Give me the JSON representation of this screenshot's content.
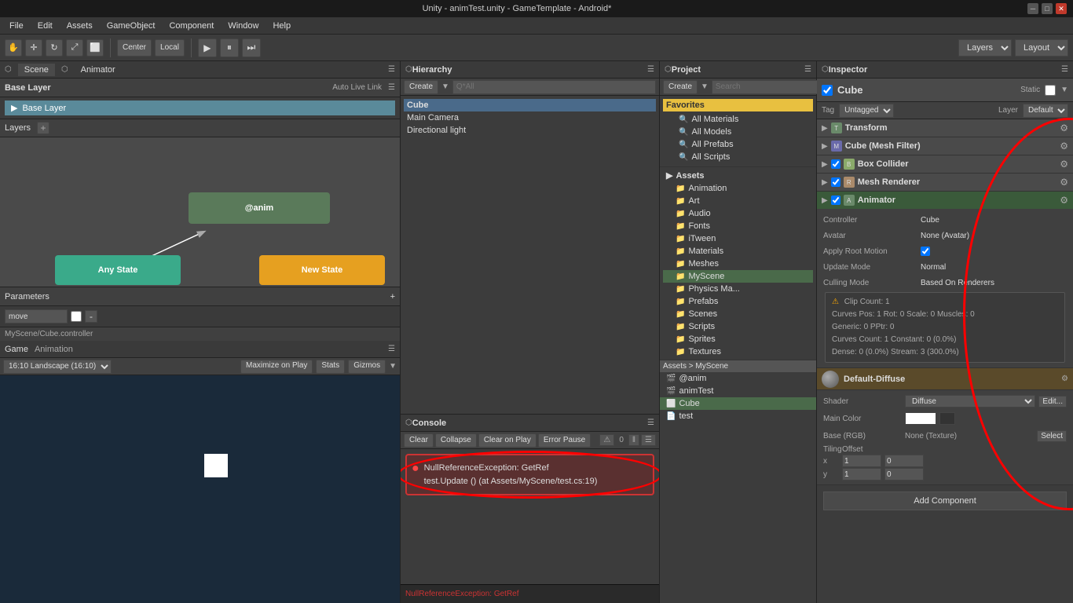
{
  "window": {
    "title": "Unity - animTest.unity - GameTemplate - Android*",
    "controls": [
      "minimize",
      "maximize",
      "close"
    ]
  },
  "menu": {
    "items": [
      "File",
      "Edit",
      "Assets",
      "GameObject",
      "Component",
      "Window",
      "Help"
    ]
  },
  "toolbar": {
    "tools": [
      "hand",
      "move",
      "rotate",
      "scale",
      "rect"
    ],
    "center_label": "Center",
    "local_label": "Local",
    "layers_label": "Layers",
    "layout_label": "Layout"
  },
  "scene_tab": "Scene",
  "animator_tab": "Animator",
  "animator": {
    "base_layer_label": "Base Layer",
    "auto_live_link": "Auto Live Link",
    "layers_label": "Layers",
    "add_layer_btn": "+",
    "params_label": "Parameters",
    "add_param_btn": "+",
    "param_name": "move",
    "footer_path": "MyScene/Cube.controller",
    "states": {
      "anim": "@anim",
      "any_state": "Any State",
      "new_state": "New State"
    }
  },
  "hierarchy": {
    "title": "Hierarchy",
    "create_btn": "Create",
    "search_placeholder": "Q*All",
    "items": [
      "Cube",
      "Main Camera",
      "Directional light"
    ]
  },
  "project": {
    "title": "Project",
    "create_btn": "Create",
    "search_placeholder": "Search",
    "favorites": {
      "label": "Favorites",
      "items": [
        "All Materials",
        "All Models",
        "All Prefabs",
        "All Scripts"
      ]
    },
    "assets": {
      "label": "Assets",
      "breadcrumb": "Assets > MyScene",
      "folders": [
        "Animation",
        "Art",
        "Audio",
        "Fonts",
        "iTween",
        "Materials",
        "Meshes",
        "MyScene",
        "Physics Ma...",
        "Prefabs",
        "Scenes",
        "Scripts",
        "Sprites",
        "Textures"
      ],
      "myscene_items": [
        "@anim",
        "animTest",
        "Cube",
        "test"
      ]
    }
  },
  "inspector": {
    "title": "Inspector",
    "object_name": "Cube",
    "static_label": "Static",
    "tag": "Untagged",
    "layer": "Default",
    "components": {
      "transform": "Transform",
      "mesh_filter": "Cube (Mesh Filter)",
      "box_collider": "Box Collider",
      "mesh_renderer": "Mesh Renderer",
      "animator": "Animator"
    },
    "animator_props": {
      "controller_label": "Controller",
      "controller_value": "Cube",
      "avatar_label": "Avatar",
      "avatar_value": "None (Avatar)",
      "apply_root_label": "Apply Root Motion",
      "update_mode_label": "Update Mode",
      "update_mode_value": "Normal",
      "culling_mode_label": "Culling Mode",
      "culling_mode_value": "Based On Renderers"
    },
    "animator_info": {
      "line1": "Clip Count: 1",
      "line2": "Curves Pos: 1 Rot: 0 Scale: 0 Muscles: 0",
      "line3": "Generic: 0 PPtr: 0",
      "line4": "Curves Count: 1 Constant: 0 (0.0%)",
      "line5": "Dense: 0 (0.0%) Stream: 3 (300.0%)"
    },
    "material": {
      "name": "Default-Diffuse",
      "shader_label": "Shader",
      "shader_value": "Diffuse",
      "edit_btn": "Edit...",
      "main_color_label": "Main Color",
      "base_label": "Base (RGB)",
      "base_value": "None (Texture)",
      "tiling_label": "Tiling",
      "offset_label": "Offset",
      "tiling_x": "1",
      "tiling_y": "1",
      "offset_x": "0",
      "offset_y": "0",
      "select_btn": "Select"
    },
    "add_component_btn": "Add Component"
  },
  "game_panel": {
    "title": "Game",
    "animation_tab": "Animation",
    "resolution": "16:10 Landscape (16:10)",
    "maximize_btn": "Maximize on Play",
    "stats_btn": "Stats",
    "gizmos_btn": "Gizmos"
  },
  "console": {
    "title": "Console",
    "clear_btn": "Clear",
    "collapse_btn": "Collapse",
    "clear_on_play_btn": "Clear on Play",
    "error_pause_btn": "Error Pause",
    "error_count": "0",
    "error_message": "NullReferenceException: GetRef",
    "error_detail": "test.Update () (at Assets/MyScene/test.cs:19)",
    "footer_message": "NullReferenceException: GetRef"
  }
}
